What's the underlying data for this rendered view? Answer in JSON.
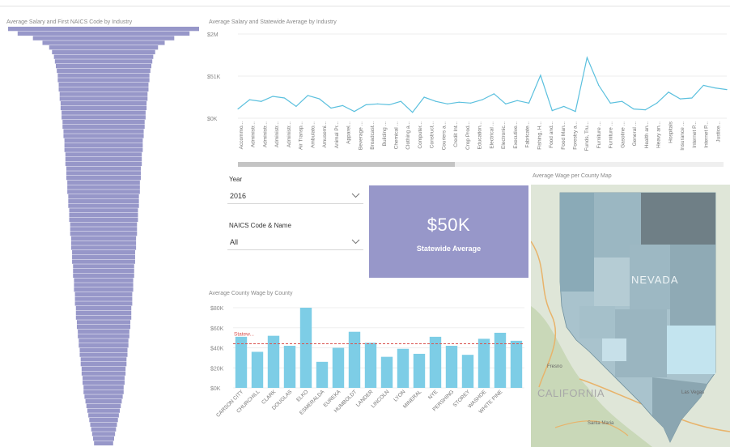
{
  "funnel": {
    "title": "Average Salary and First NAICS Code by Industry",
    "color": "#9797c9"
  },
  "line_chart": {
    "title": "Average Salary and Statewide Average by Industry",
    "color": "#5bc0de"
  },
  "slicers": {
    "year": {
      "label": "Year",
      "value": "2016"
    },
    "naics": {
      "label": "NAICS Code & Name",
      "value": "All"
    }
  },
  "kpi_card": {
    "value": "$50K",
    "label": "Statewide Average",
    "color": "#9797c9"
  },
  "bar_chart": {
    "title": "Average County Wage by County",
    "color": "#7dcde6",
    "ref_color": "#d9534f"
  },
  "map": {
    "title": "Average Wage per County Map",
    "labels": {
      "nevada": "NEVADA",
      "california": "CALIFORNIA"
    },
    "place_labels": [
      "Las Vegas",
      "Fresno",
      "Santa Maria"
    ]
  },
  "chart_data": [
    {
      "type": "bar",
      "title": "Average Salary and First NAICS Code by Industry",
      "orientation": "horizontal",
      "note": "Sorted descending funnel; bars centered",
      "values": [
        100,
        90,
        74,
        64,
        57,
        54,
        52,
        51,
        50,
        49,
        48,
        48,
        47,
        47,
        46,
        46,
        45,
        45,
        44,
        44,
        43,
        43,
        42,
        42,
        41,
        41,
        41,
        40,
        40,
        40,
        39,
        39,
        39,
        38,
        38,
        38,
        37,
        37,
        37,
        36,
        36,
        36,
        35,
        35,
        35,
        34,
        34,
        34,
        33,
        33,
        33,
        32,
        32,
        32,
        31,
        31,
        31,
        30,
        30,
        30,
        29,
        29,
        29,
        28,
        28,
        27,
        27,
        26,
        26,
        25,
        25,
        24,
        24,
        23,
        23,
        22,
        22,
        21,
        21,
        20,
        19,
        18,
        17,
        16,
        15,
        14,
        13,
        12,
        11,
        10
      ]
    },
    {
      "type": "line",
      "title": "Average Salary and Statewide Average by Industry",
      "y_ticks": [
        "$0K",
        "$51K",
        "$2M"
      ],
      "y_tick_values": [
        0,
        1,
        2
      ],
      "ylim": [
        0,
        2
      ],
      "x": [
        "Accommo...",
        "Administr...",
        "Administr...",
        "Administr...",
        "Administr...",
        "Air Transp...",
        "Ambulato...",
        "Amusemi...",
        "Animal Pr...",
        "Apparel...",
        "Beverage ...",
        "Broadcast...",
        "Building ...",
        "Chemical ...",
        "Clothing a...",
        "Computer...",
        "Construct...",
        "Couriers a...",
        "Credit Int...",
        "Crop Prod...",
        "Education...",
        "Electrical ...",
        "Electronic...",
        "Executive...",
        "Fabricate...",
        "Fishing, H...",
        "Food and...",
        "Food Man...",
        "Forestry a...",
        "Funds, Tru...",
        "Furniture ...",
        "Furniture ...",
        "Gasoline ...",
        "General ...",
        "Health an...",
        "Heavy an...",
        "Hospitals",
        "Insurance ...",
        "Internet P...",
        "Internet P...",
        "Justice..."
      ],
      "values": [
        0.22,
        0.44,
        0.4,
        0.52,
        0.48,
        0.28,
        0.54,
        0.46,
        0.24,
        0.3,
        0.16,
        0.32,
        0.34,
        0.32,
        0.4,
        0.14,
        0.5,
        0.4,
        0.34,
        0.38,
        0.36,
        0.44,
        0.58,
        0.34,
        0.42,
        0.36,
        1.02,
        0.18,
        0.28,
        0.16,
        1.44,
        0.78,
        0.36,
        0.4,
        0.22,
        0.2,
        0.36,
        0.62,
        0.46,
        0.48,
        0.78,
        0.72,
        0.68
      ]
    },
    {
      "type": "bar",
      "title": "Average County Wage by County",
      "y_ticks": [
        "$0K",
        "$20K",
        "$40K",
        "$60K",
        "$80K"
      ],
      "ylim": [
        0,
        80
      ],
      "reference_line": {
        "label": "Statew...",
        "value": 44
      },
      "categories": [
        "CARSON CITY",
        "CHURCHILL",
        "CLARK",
        "DOUGLAS",
        "ELKO",
        "ESMERALDA",
        "EUREKA",
        "HUMBOLDT",
        "LANDER",
        "LINCOLN",
        "LYON",
        "MINERAL",
        "NYE",
        "PERSHING",
        "STOREY",
        "WASHOE",
        "WHITE PINE"
      ],
      "values": [
        51,
        36,
        52,
        42,
        80,
        26,
        40,
        56,
        45,
        31,
        39,
        34,
        51,
        42,
        33,
        49,
        55,
        47
      ]
    }
  ]
}
